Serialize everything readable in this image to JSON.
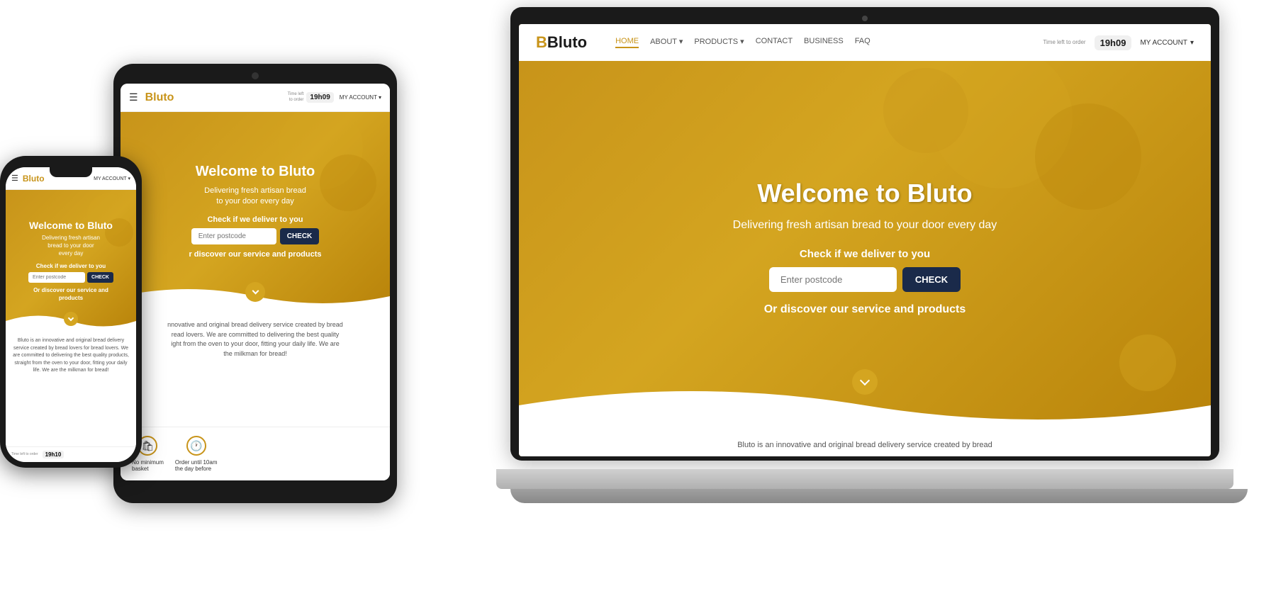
{
  "brand": {
    "name": "Bluto",
    "logo_text": "Bluto",
    "accent_color": "#c8941a"
  },
  "laptop": {
    "nav": {
      "logo": "Bluto",
      "links": [
        "HOME",
        "ABOUT",
        "PRODUCTS",
        "CONTACT",
        "BUSINESS",
        "FAQ"
      ],
      "time_label": "Time left\nto order",
      "time_value": "19h09",
      "account_label": "MY ACCOUNT"
    },
    "hero": {
      "heading": "Welcome to Bluto",
      "subheading": "Delivering fresh artisan bread\nto your door every day",
      "check_label": "Check if we deliver to you",
      "postcode_placeholder": "Enter postcode",
      "check_button": "CHECK",
      "discover_text": "Or discover our service and products"
    },
    "about": {
      "text": "Bluto is an innovative and original bread delivery service created by bread"
    }
  },
  "tablet": {
    "nav": {
      "logo": "Bluto",
      "time_label": "Time left\nto order",
      "time_value": "19h09",
      "account_label": "MY ACCOUNT"
    },
    "hero": {
      "heading": "Welcome to Bluto",
      "subheading": "Delivering fresh artisan bread\nto your door every day",
      "check_label": "Check if we deliver to you",
      "postcode_placeholder": "Enter postcode",
      "check_button": "CHECK",
      "discover_text": "r discover our service and products"
    },
    "about": {
      "text": "nnovative and original bread delivery service created by bread\nread lovers. We are committed to delivering the best quality\night from the oven to your door, fitting your daily life. We are\nthe milkman for bread!"
    },
    "features": [
      {
        "icon": "🛍",
        "label": "No minimum\nbasket"
      },
      {
        "icon": "🕐",
        "label": "Order until 10am\nthe day before"
      }
    ]
  },
  "phone": {
    "nav": {
      "logo": "Bluto",
      "account_label": "MY ACCOUNT"
    },
    "hero": {
      "heading": "Welcome to Bluto",
      "subheading": "Delivering fresh artisan\nbread to your door\nevery day",
      "check_label": "Check if we deliver to you",
      "postcode_placeholder": "Enter postcode",
      "check_button": "CHECK",
      "discover_text": "Or discover our service and\nproducts"
    },
    "about": {
      "text": "Bluto is an innovative and original bread delivery service created by bread lovers for bread lovers. We are committed to delivering the best quality products, straight from the oven to your door, fitting your daily life. We are the milkman for bread!"
    },
    "footer": {
      "time_label": "Time left\nto order",
      "time_value": "19h10"
    }
  }
}
